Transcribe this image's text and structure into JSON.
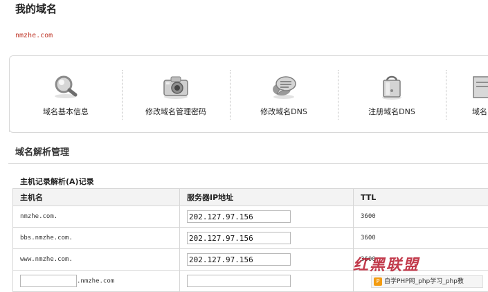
{
  "page": {
    "title": "我的域名",
    "domain": "nmzhe.com"
  },
  "toolbar": {
    "items": [
      {
        "label": "域名基本信息",
        "icon": "magnifier-icon"
      },
      {
        "label": "修改域名管理密码",
        "icon": "camera-icon"
      },
      {
        "label": "修改域名DNS",
        "icon": "chat-bubble-icon"
      },
      {
        "label": "注册域名DNS",
        "icon": "shopping-bag-icon"
      },
      {
        "label": "域名",
        "icon": "document-icon"
      }
    ]
  },
  "dns_section": {
    "title": "域名解析管理",
    "table_title": "主机记录解析(A)记录",
    "headers": {
      "host": "主机名",
      "ip": "服务器IP地址",
      "ttl": "TTL"
    },
    "rows": [
      {
        "host": "nmzhe.com.",
        "ip": "202.127.97.156",
        "ttl": "3600"
      },
      {
        "host": "bbs.nmzhe.com.",
        "ip": "202.127.97.156",
        "ttl": "3600"
      },
      {
        "host": "www.nmzhe.com.",
        "ip": "202.127.97.156",
        "ttl": "3600"
      }
    ],
    "new_row": {
      "host_value": "",
      "host_suffix": ".nmzhe.com",
      "ip_value": ""
    }
  },
  "overlay": {
    "watermark": "红黑联盟",
    "php_bar_text": "自学PHP网_php学习_php教"
  }
}
